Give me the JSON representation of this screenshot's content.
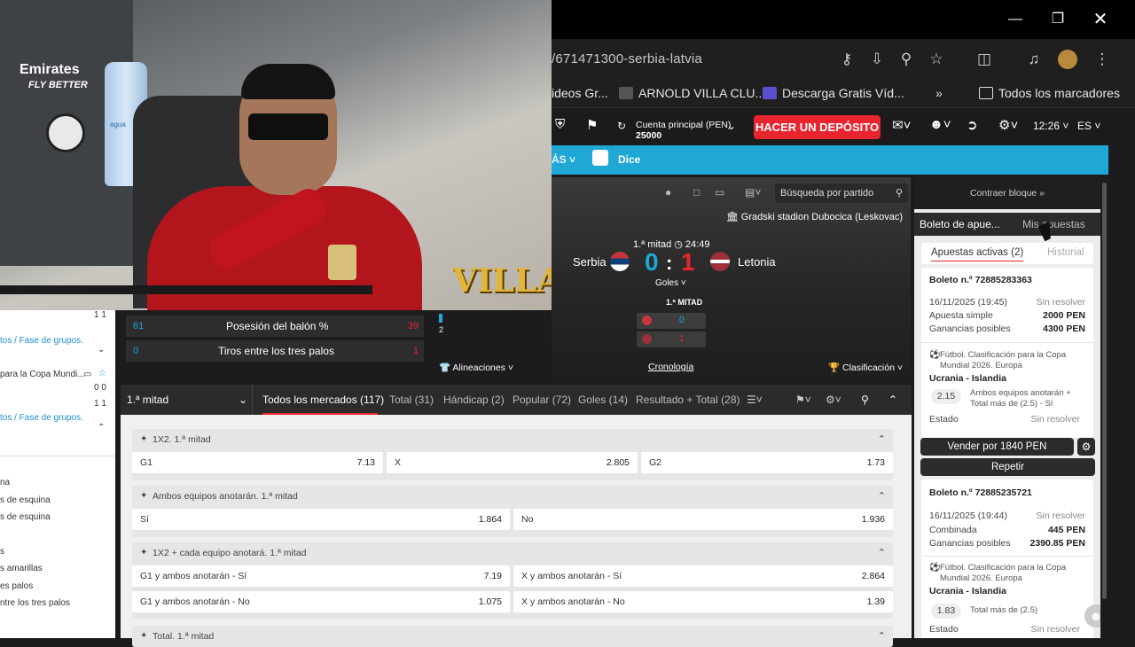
{
  "browser": {
    "url": "/671471300-serbia-latvia",
    "bookmarks": [
      "ideos Gr...",
      "ARNOLD VILLA CLU...",
      "Descarga Gratis Víd...",
      "Todos los marcadores"
    ]
  },
  "header": {
    "account_label": "Cuenta principal",
    "currency": "(PEN)",
    "balance": "25000",
    "deposit": "HACER UN DEPÓSITO",
    "time": "12:26",
    "lang": "ES"
  },
  "nav": {
    "more": "ÁS",
    "dice": "Dice"
  },
  "stream": {
    "search_placeholder": "Búsqueda por partido",
    "stadium": "Gradski stadion Dubocica (Leskovac)",
    "period": "1.ª mitad",
    "clock": "24:49",
    "home": "Serbia",
    "away": "Letonia",
    "home_score": "0",
    "away_score": "1",
    "sep": ":",
    "goals": "Goles",
    "half_label": "1.ª MITAD",
    "home_goals_half": "0",
    "away_goals_half": "1",
    "lineups": "Alineaciones",
    "timeline": "Cronología",
    "standings": "Clasificación",
    "bar_count": "2"
  },
  "stats": {
    "possession_label": "Posesión del balón %",
    "possession_home": "61",
    "possession_away": "39",
    "shots_label": "Tiros entre los tres palos",
    "shots_home": "0",
    "shots_away": "1"
  },
  "webcam": {
    "banner": "Emirates",
    "banner2": "FLY BETTER",
    "brand": "VILLA",
    "bottle": "agua"
  },
  "left_panel": {
    "lines": [
      {
        "text": "1 1"
      },
      {
        "text": "tos / Fase de grupos."
      },
      {
        "text": "para la Copa Mundi..."
      },
      {
        "text": "0 0"
      },
      {
        "text": "1 1"
      },
      {
        "text": "tos / Fase de grupos."
      },
      {
        "text": "na"
      },
      {
        "text": "s de esquina"
      },
      {
        "text": "s de esquina"
      },
      {
        "text": "s"
      },
      {
        "text": "s amarillas"
      },
      {
        "text": "es palos"
      },
      {
        "text": "ntre los tres palos"
      }
    ]
  },
  "market_tabs": {
    "period": "1.ª mitad",
    "tabs": [
      "Todos los mercados (117)",
      "Total (31)",
      "Hándicap (2)",
      "Popular (72)",
      "Goles (14)",
      "Resultado + Total (28)"
    ]
  },
  "markets": [
    {
      "title": "1X2. 1.ª mitad",
      "odds": [
        {
          "label": "G1",
          "value": "7.13"
        },
        {
          "label": "X",
          "value": "2.805"
        },
        {
          "label": "G2",
          "value": "1.73"
        }
      ]
    },
    {
      "title": "Ambos equipos anotarán. 1.ª mitad",
      "odds": [
        {
          "label": "Sí",
          "value": "1.864"
        },
        {
          "label": "No",
          "value": "1.936"
        }
      ]
    },
    {
      "title": "1X2 + cada equipo anotará. 1.ª mitad",
      "odds": [
        {
          "label": "G1 y ambos anotarán - Sí",
          "value": "7.19"
        },
        {
          "label": "X y ambos anotarán - Sí",
          "value": "2.864"
        },
        {
          "label": "G1 y ambos anotarán - No",
          "value": "1.075"
        },
        {
          "label": "X y ambos anotarán - No",
          "value": "1.39"
        }
      ]
    },
    {
      "title": "Total. 1.ª mitad",
      "odds": []
    }
  ],
  "slip": {
    "collapse": "Contraer bloque",
    "tab_slip": "Boleto de apue...",
    "tab_mine": "Mis apuestas",
    "subtab_active": "Apuestas activas (2)",
    "subtab_history": "Historial",
    "tickets": [
      {
        "number": "Boleto n.º 72885283363",
        "date": "16/11/2025 (19:45)",
        "status": "Sin resolver",
        "type": "Apuesta simple",
        "stake": "2000 PEN",
        "gain_label": "Ganancias posibles",
        "gain": "4300 PEN",
        "event": "Fútbol. Clasificación para la Copa Mundial 2026. Europa",
        "match": "Ucrania - Islandia",
        "odd": "2.15",
        "pick": "Ambos equipos anotarán + Total más de (2.5) - Sí",
        "state_label": "Estado",
        "state": "Sin resolver"
      },
      {
        "number": "Boleto n.º 72885235721",
        "date": "16/11/2025 (19:44)",
        "status": "Sin resolver",
        "type": "Combinada",
        "stake": "445 PEN",
        "gain_label": "Ganancias posibles",
        "gain": "2390.85 PEN",
        "event": "Fútbol. Clasificación para la Copa Mundial 2026. Europa",
        "match": "Ucrania - Islandia",
        "odd": "1.83",
        "pick": "Total más de (2.5)",
        "state_label": "Estado",
        "state": "Sin resolver"
      }
    ],
    "sell": "Vender por 1840 PEN",
    "repeat": "Repetir"
  },
  "colors": {
    "accent": "#1fa7d6",
    "deposit": "#e8242f",
    "home": "#1fa7d6",
    "away": "#e8242f"
  }
}
